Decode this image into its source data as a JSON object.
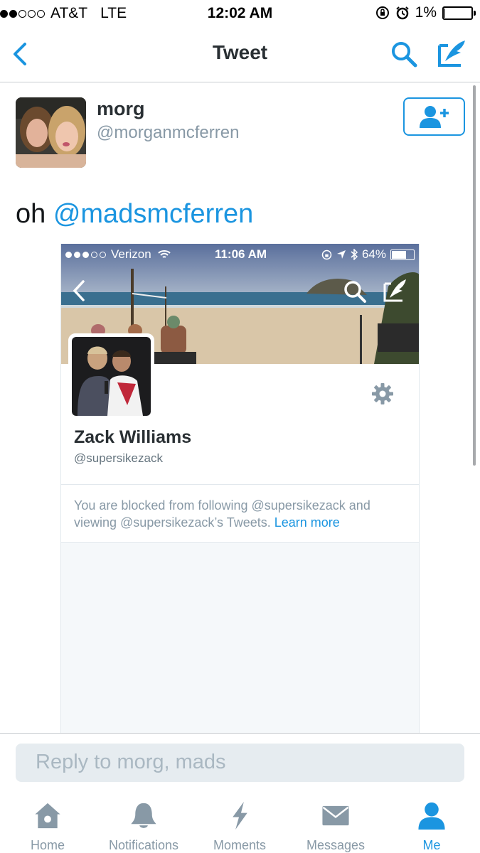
{
  "status_bar": {
    "carrier": "AT&T",
    "network": "LTE",
    "time": "12:02 AM",
    "battery": "1%",
    "battery_level": 0.01
  },
  "nav": {
    "title": "Tweet",
    "back_icon": "chevron-left-icon",
    "search_icon": "search-icon",
    "compose_icon": "compose-tweet-icon"
  },
  "tweet": {
    "display_name": "morg",
    "handle": "@morganmcferren",
    "text_prefix": "oh ",
    "mention": "@madsmcferren",
    "follow_icon": "follow-user-icon"
  },
  "embedded_screenshot": {
    "status_bar": {
      "carrier": "Verizon",
      "time": "11:06 AM",
      "battery": "64%",
      "battery_level": 0.64
    },
    "profile": {
      "name": "Zack Williams",
      "handle": "@supersikezack"
    },
    "notice": {
      "text": "You are blocked from following @supersikezack and viewing @supersikezack’s Tweets. ",
      "link": "Learn more"
    }
  },
  "reply": {
    "placeholder": "Reply to morg, mads"
  },
  "tab_bar": {
    "items": [
      {
        "label": "Home",
        "icon": "home-icon"
      },
      {
        "label": "Notifications",
        "icon": "bell-icon"
      },
      {
        "label": "Moments",
        "icon": "lightning-icon"
      },
      {
        "label": "Messages",
        "icon": "envelope-icon"
      },
      {
        "label": "Me",
        "icon": "person-icon",
        "active": true
      }
    ]
  },
  "colors": {
    "accent": "#1b95e0",
    "muted": "#8899a6",
    "border": "#e1e8ed"
  }
}
